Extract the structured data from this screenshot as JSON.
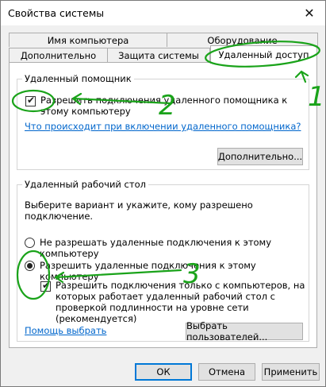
{
  "window": {
    "title": "Свойства системы",
    "close_glyph": "✕"
  },
  "tabs": {
    "row1": [
      "Имя компьютера",
      "Оборудование"
    ],
    "row2": [
      "Дополнительно",
      "Защита системы",
      "Удаленный доступ"
    ],
    "active": "Удаленный доступ"
  },
  "remote_assistance": {
    "group_title": "Удаленный помощник",
    "allow_label": "Разрешить подключения удаленного помощника к этому компьютеру",
    "allow_checked": true,
    "help_link": "Что происходит при включении удаленного помощника?",
    "advanced_button": "Дополнительно..."
  },
  "remote_desktop": {
    "group_title": "Удаленный рабочий стол",
    "instructions": "Выберите вариант и укажите, кому разрешено подключение.",
    "option_deny": "Не разрешать удаленные подключения к этому компьютеру",
    "option_allow": "Разрешить удаленные подключения к этому компьютеру",
    "selected_option": "allow",
    "nla_label": "Разрешить подключения только с компьютеров, на которых работает удаленный рабочий стол с проверкой подлинности на уровне сети (рекомендуется)",
    "nla_checked": true,
    "help_link": "Помощь выбрать",
    "select_users_button": "Выбрать пользователей..."
  },
  "dialog_buttons": {
    "ok": "ОК",
    "cancel": "Отмена",
    "apply": "Применить"
  },
  "annotations": {
    "color": "#1aa31a",
    "marks": [
      "1",
      "2",
      "3"
    ]
  }
}
